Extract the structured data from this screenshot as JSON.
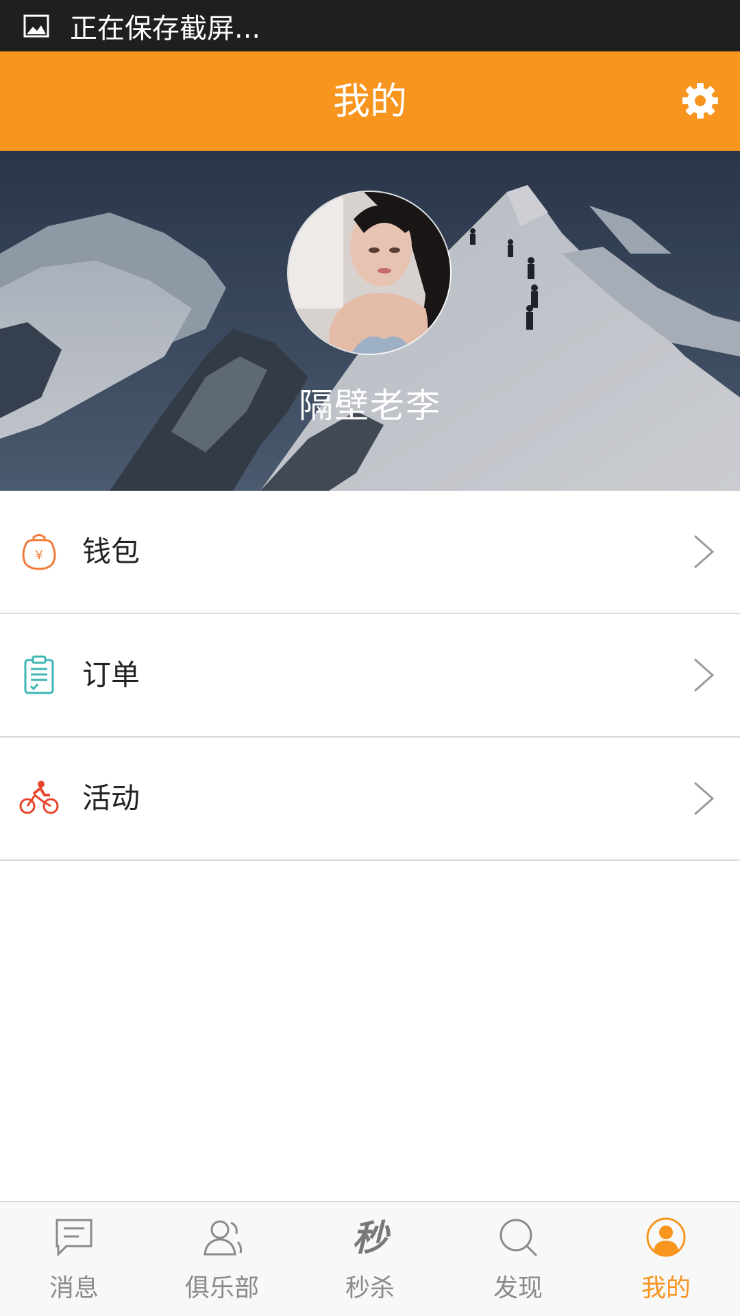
{
  "status_bar": {
    "text": "正在保存截屏...",
    "icon": "image-icon"
  },
  "header": {
    "title": "我的",
    "settings_icon": "gear-icon",
    "background_color": "#f7951f"
  },
  "profile": {
    "username": "隔壁老李"
  },
  "menu": {
    "items": [
      {
        "label": "钱包",
        "icon": "wallet-icon",
        "icon_color": "#f07a3a"
      },
      {
        "label": "订单",
        "icon": "clipboard-icon",
        "icon_color": "#3fb6b3"
      },
      {
        "label": "活动",
        "icon": "bicycle-icon",
        "icon_color": "#e8452c"
      }
    ]
  },
  "tab_bar": {
    "active_index": 4,
    "active_color": "#f7951f",
    "tabs": [
      {
        "label": "消息",
        "icon": "message-icon"
      },
      {
        "label": "俱乐部",
        "icon": "people-icon"
      },
      {
        "label": "秒杀",
        "icon": "flash-sale-icon",
        "icon_text": "秒"
      },
      {
        "label": "发现",
        "icon": "search-icon"
      },
      {
        "label": "我的",
        "icon": "profile-icon"
      }
    ]
  }
}
